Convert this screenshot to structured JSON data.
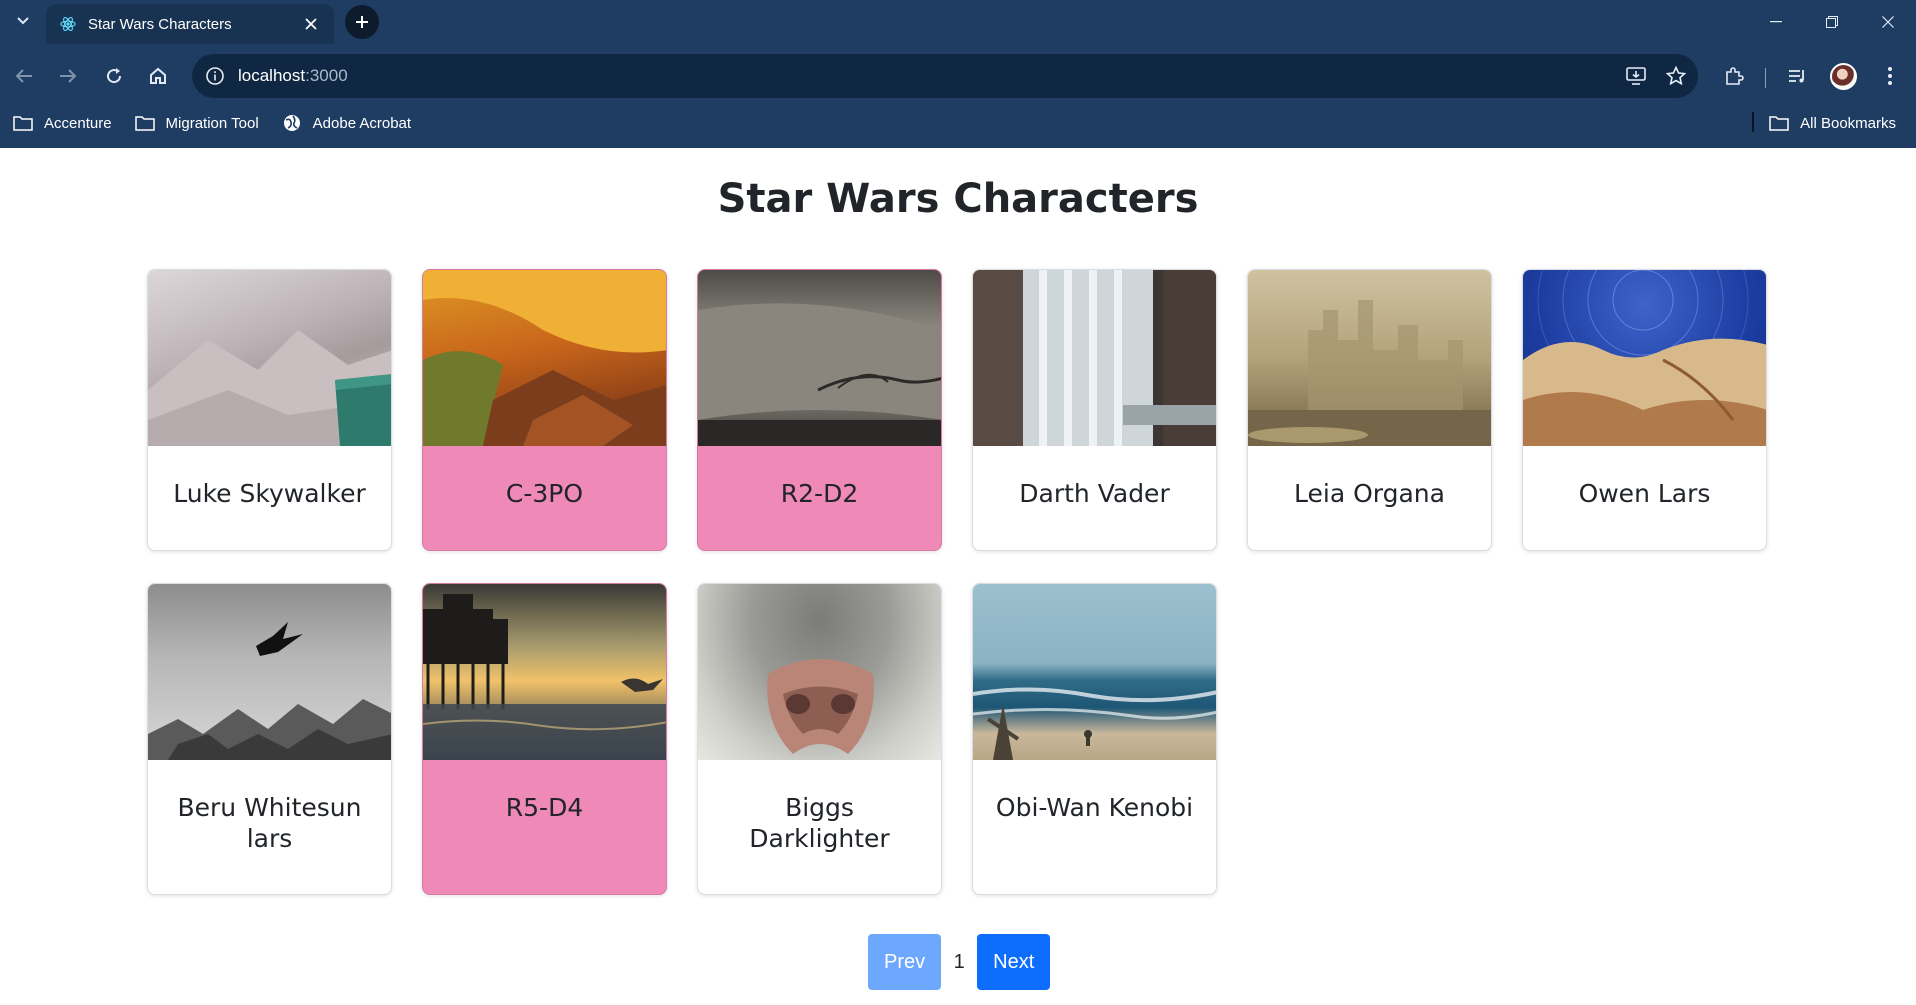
{
  "browser": {
    "tab_title": "Star Wars Characters",
    "url_host": "localhost",
    "url_port": ":3000",
    "bookmarks": [
      {
        "label": "Accenture",
        "icon": "folder-icon"
      },
      {
        "label": "Migration Tool",
        "icon": "folder-icon"
      },
      {
        "label": "Adobe Acrobat",
        "icon": "globe-icon"
      }
    ],
    "all_bookmarks_label": "All Bookmarks"
  },
  "page": {
    "title": "Star Wars Characters",
    "characters": [
      {
        "name": "Luke Skywalker",
        "highlighted": false,
        "image": "misty-mountains-with-mug"
      },
      {
        "name": "C-3PO",
        "highlighted": true,
        "image": "orange-canyon-rocks"
      },
      {
        "name": "R2-D2",
        "highlighted": true,
        "image": "vintage-car-emblem"
      },
      {
        "name": "Darth Vader",
        "highlighted": false,
        "image": "window-curtain"
      },
      {
        "name": "Leia Organa",
        "highlighted": false,
        "image": "hazy-city-skyline"
      },
      {
        "name": "Owen Lars",
        "highlighted": false,
        "image": "star-trails-over-rocks"
      },
      {
        "name": "Beru Whitesun lars",
        "highlighted": false,
        "image": "bird-over-snowy-peaks"
      },
      {
        "name": "R5-D4",
        "highlighted": true,
        "image": "pier-at-sunset"
      },
      {
        "name": "Biggs Darklighter",
        "highlighted": false,
        "image": "animal-nose-closeup"
      },
      {
        "name": "Obi-Wan Kenobi",
        "highlighted": false,
        "image": "beach-waves"
      }
    ],
    "pagination": {
      "prev_label": "Prev",
      "current_page": "1",
      "next_label": "Next"
    }
  },
  "colors": {
    "chrome_bg": "#1f3d63",
    "droid_card_bg": "#ef89b7",
    "primary": "#0d6efd",
    "primary_disabled": "#6ea8fe"
  }
}
